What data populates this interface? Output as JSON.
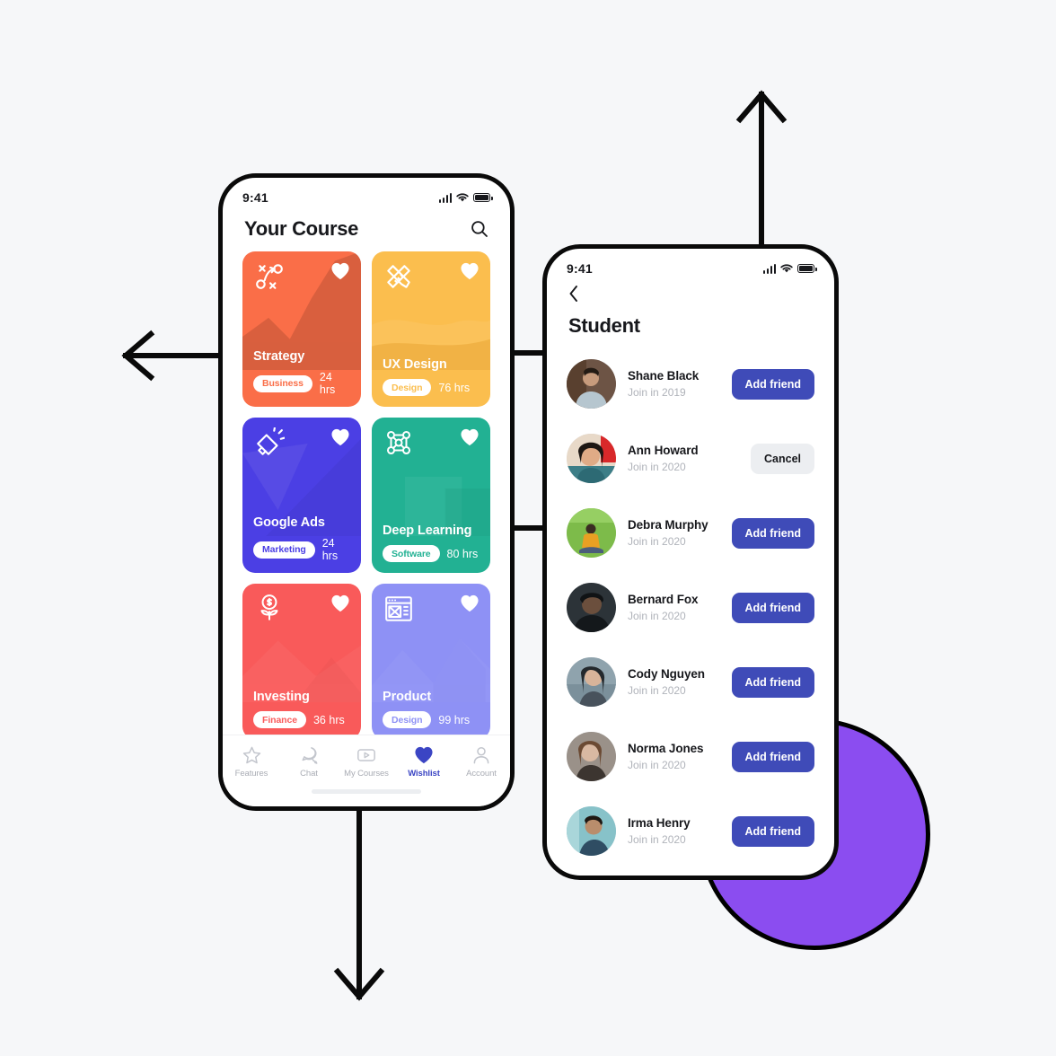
{
  "canvas": {
    "background": "#f6f7f9",
    "purple_circle_color": "#8b4df0",
    "outline_color": "#0a0a0a"
  },
  "arrows": [
    {
      "name": "arrow-left",
      "direction": "left"
    },
    {
      "name": "arrow-up",
      "direction": "up"
    },
    {
      "name": "arrow-down",
      "direction": "down"
    },
    {
      "name": "connector-top",
      "direction": "horizontal"
    },
    {
      "name": "connector-bottom",
      "direction": "horizontal"
    }
  ],
  "phone_courses": {
    "status": {
      "time": "9:41",
      "signal_icon": "signal-bars-icon",
      "wifi_icon": "wifi-icon",
      "battery_icon": "battery-icon"
    },
    "header": {
      "title": "Your Course",
      "search_icon": "search-icon"
    },
    "courses": [
      {
        "title": "Strategy",
        "tag": "Business",
        "hours": "24 hrs",
        "color": "#fa6e48",
        "icon": "strategy-playbook-icon",
        "favorite": true
      },
      {
        "title": "UX Design",
        "tag": "Design",
        "hours": "76 hrs",
        "color": "#fbbe4e",
        "icon": "ruler-pencil-icon",
        "favorite": true
      },
      {
        "title": "Google Ads",
        "tag": "Marketing",
        "hours": "24 hrs",
        "color": "#4b3fe4",
        "icon": "megaphone-icon",
        "favorite": true
      },
      {
        "title": "Deep Learning",
        "tag": "Software",
        "hours": "80 hrs",
        "color": "#22b193",
        "icon": "neural-network-icon",
        "favorite": true
      },
      {
        "title": "Investing",
        "tag": "Finance",
        "hours": "36 hrs",
        "color": "#f95a5a",
        "icon": "money-plant-icon",
        "favorite": true
      },
      {
        "title": "Product",
        "tag": "Design",
        "hours": "99 hrs",
        "color": "#8e91f5",
        "icon": "wireframe-layout-icon",
        "favorite": true
      }
    ],
    "tabs": [
      {
        "label": "Features",
        "icon": "star-icon",
        "active": false
      },
      {
        "label": "Chat",
        "icon": "chat-bubble-icon",
        "active": false
      },
      {
        "label": "My Courses",
        "icon": "play-video-icon",
        "active": false
      },
      {
        "label": "Wishlist",
        "icon": "heart-icon",
        "active": true
      },
      {
        "label": "Account",
        "icon": "person-icon",
        "active": false
      }
    ],
    "active_tab_color": "#3b45c4"
  },
  "phone_students": {
    "status": {
      "time": "9:41",
      "signal_icon": "signal-bars-icon",
      "wifi_icon": "wifi-icon",
      "battery_icon": "battery-icon"
    },
    "header": {
      "back_icon": "chevron-left-icon",
      "title": "Student"
    },
    "students": [
      {
        "name": "Shane Black",
        "join": "Join in 2019",
        "action": "Add friend",
        "state": "add",
        "avatar_colors": [
          "#6d5445",
          "#b6c6cf"
        ]
      },
      {
        "name": "Ann Howard",
        "join": "Join in 2020",
        "action": "Cancel",
        "state": "cancel",
        "avatar_colors": [
          "#d8282a",
          "#e8d9c8"
        ]
      },
      {
        "name": "Debra Murphy",
        "join": "Join in 2020",
        "action": "Add friend",
        "state": "add",
        "avatar_colors": [
          "#7dbb4a",
          "#e8a023"
        ]
      },
      {
        "name": "Bernard Fox",
        "join": "Join in 2020",
        "action": "Add friend",
        "state": "add",
        "avatar_colors": [
          "#2c3338",
          "#14181b"
        ]
      },
      {
        "name": "Cody Nguyen",
        "join": "Join in 2020",
        "action": "Add friend",
        "state": "add",
        "avatar_colors": [
          "#8fa3ad",
          "#48525c"
        ]
      },
      {
        "name": "Norma Jones",
        "join": "Join in 2020",
        "action": "Add friend",
        "state": "add",
        "avatar_colors": [
          "#9a9189",
          "#3c3530"
        ]
      },
      {
        "name": "Irma Henry",
        "join": "Join in 2020",
        "action": "Add friend",
        "state": "add",
        "avatar_colors": [
          "#87c2c9",
          "#2f4d63"
        ]
      }
    ],
    "add_button_color": "#3f4bb8",
    "cancel_button_color": "#eceef1"
  }
}
